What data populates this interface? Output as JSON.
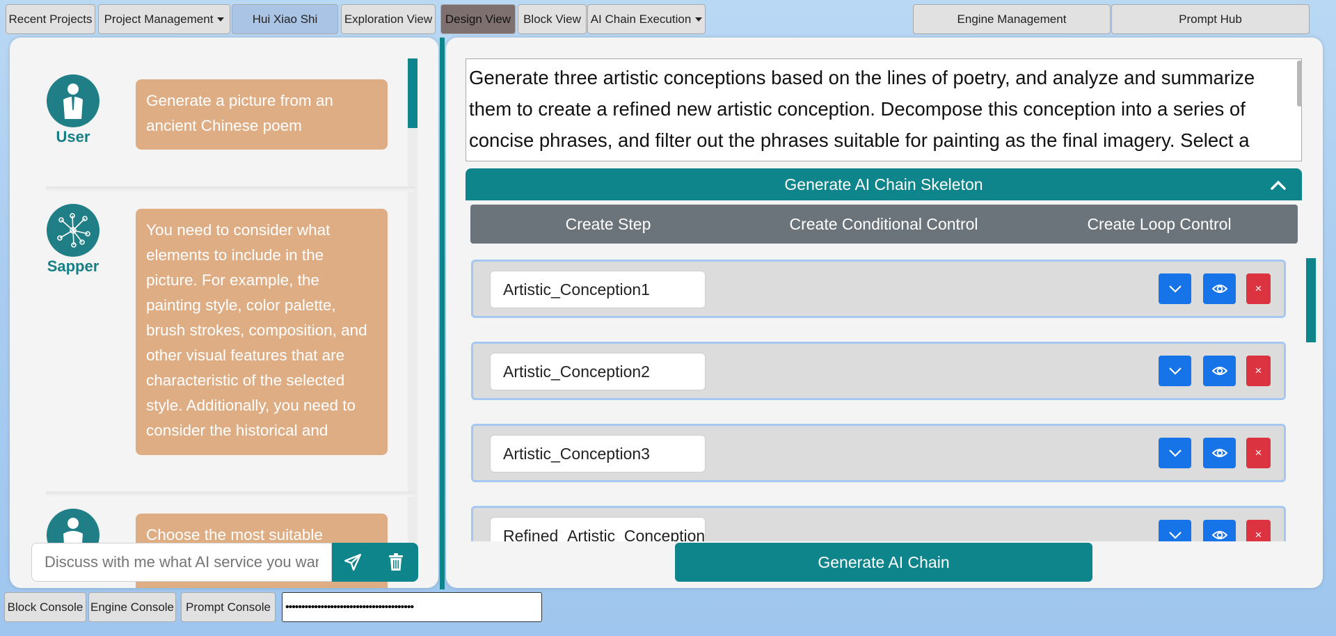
{
  "topbar": {
    "recent_projects": "Recent Projects",
    "project_management": "Project Management",
    "hui_xiao_shi": "Hui Xiao Shi",
    "exploration_view": "Exploration View",
    "design_view": "Design View",
    "block_view": "Block View",
    "ai_chain_execution": "AI Chain Execution",
    "engine_management": "Engine Management",
    "prompt_hub": "Prompt Hub"
  },
  "chat": {
    "messages": [
      {
        "role": "User",
        "text": "Generate a picture from an ancient Chinese poem",
        "icon": "user-icon"
      },
      {
        "role": "Sapper",
        "text": "You need to consider what elements to include in the picture. For example, the painting style, color palette, brush strokes, composition, and other visual features that are characteristic of the selected style. Additionally, you need to consider the historical and",
        "icon": "network-icon"
      },
      {
        "role": "",
        "text": "Choose the most suitable",
        "icon": "user-icon"
      }
    ],
    "input_placeholder": "Discuss with me what AI service you want",
    "colors": {
      "bubble": "#dfad84",
      "accent": "#0e858a"
    }
  },
  "design": {
    "prompt_text": "Generate three artistic conceptions based on the lines of poetry, and analyze and summarize them to create a refined new artistic conception. Decompose this conception into a series of concise phrases, and filter out the phrases suitable for painting as the final imagery.  Select a",
    "skeleton_header": "Generate AI Chain Skeleton",
    "create_step": "Create Step",
    "create_conditional": "Create Conditional Control",
    "create_loop": "Create Loop Control",
    "steps": [
      "Artistic_Conception1",
      "Artistic_Conception2",
      "Artistic_Conception3",
      "Refined_Artistic_Conception"
    ],
    "generate_chain": "Generate AI Chain"
  },
  "bottombar": {
    "block_console": "Block Console",
    "engine_console": "Engine Console",
    "prompt_console": "Prompt Console",
    "password_value": "••••••••••••••••••••••••••••••••••••••••"
  }
}
